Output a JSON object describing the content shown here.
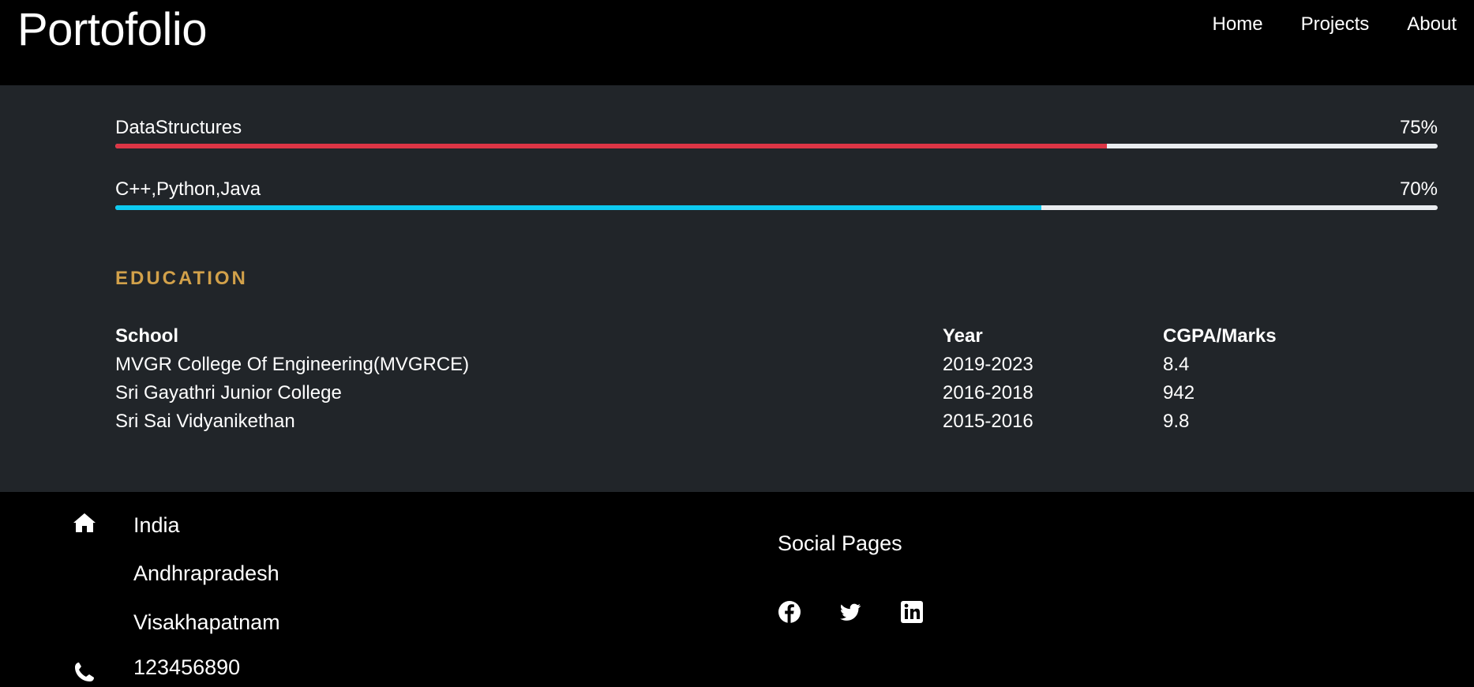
{
  "brand": "Portofolio",
  "nav": {
    "items": [
      "Home",
      "Projects",
      "About"
    ]
  },
  "skills": [
    {
      "name": "DataStructures",
      "percent_label": "75%",
      "value": 0.75,
      "color": "#dc3545"
    },
    {
      "name": "C++,Python,Java",
      "percent_label": "70%",
      "value": 0.7,
      "color": "#0dcaf0"
    }
  ],
  "education": {
    "title": "EDUCATION",
    "headers": [
      "School",
      "Year",
      "CGPA/Marks"
    ],
    "rows": [
      [
        "MVGR College Of Engineering(MVGRCE)",
        "2019-2023",
        "8.4"
      ],
      [
        "Sri Gayathri Junior College",
        "2016-2018",
        "942"
      ],
      [
        "Sri Sai Vidyanikethan",
        "2015-2016",
        "9.8"
      ]
    ]
  },
  "footer": {
    "address_lines": [
      "India",
      "Andhrapradesh",
      "Visakhapatnam"
    ],
    "phone": "123456890",
    "social_title": "Social Pages",
    "social_icons": [
      "facebook-icon",
      "twitter-icon",
      "linkedin-icon"
    ]
  },
  "colors": {
    "background": "#000000",
    "main_background": "#212529",
    "accent": "#d2a14a",
    "bar_track": "#e9ecef"
  }
}
